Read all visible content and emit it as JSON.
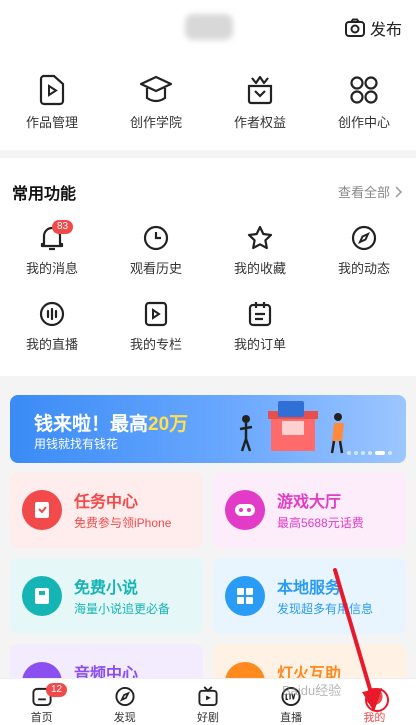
{
  "header": {
    "publish_label": "发布",
    "icon": "camera-icon"
  },
  "creator": [
    {
      "label": "作品管理",
      "icon": "video-doc-icon"
    },
    {
      "label": "创作学院",
      "icon": "graduation-cap-icon"
    },
    {
      "label": "作者权益",
      "icon": "crown-gift-icon"
    },
    {
      "label": "创作中心",
      "icon": "grid-icon"
    }
  ],
  "functions": {
    "title": "常用功能",
    "see_all": "查看全部",
    "items": [
      {
        "label": "我的消息",
        "icon": "bell-icon",
        "badge": "83"
      },
      {
        "label": "观看历史",
        "icon": "clock-icon"
      },
      {
        "label": "我的收藏",
        "icon": "star-icon"
      },
      {
        "label": "我的动态",
        "icon": "compass-icon"
      },
      {
        "label": "我的直播",
        "icon": "live-wave-icon"
      },
      {
        "label": "我的专栏",
        "icon": "play-doc-icon"
      },
      {
        "label": "我的订单",
        "icon": "order-icon"
      }
    ]
  },
  "banner": {
    "title_prefix": "钱来啦！最高",
    "title_highlight": "20万",
    "subtitle": "用钱就找有钱花"
  },
  "cards": [
    {
      "title": "任务中心",
      "subtitle": "免费参与领iPhone",
      "color": "#f24a4a",
      "bg": "#ffecec",
      "icon": "task-icon"
    },
    {
      "title": "游戏大厅",
      "subtitle": "最高5688元话费",
      "color": "#e23bc7",
      "bg": "#fdecfa",
      "icon": "gamepad-icon"
    },
    {
      "title": "免费小说",
      "subtitle": "海量小说追更必备",
      "color": "#16b5b5",
      "bg": "#e6f7f7",
      "icon": "book-icon"
    },
    {
      "title": "本地服务",
      "subtitle": "发现超多有用信息",
      "color": "#2a9cf4",
      "bg": "#e8f4fe",
      "icon": "service-grid-icon"
    },
    {
      "title": "音频中心",
      "color": "#8b4ef0",
      "bg": "#f2ecfe",
      "icon": "audio-icon"
    },
    {
      "title": "灯火互助",
      "color": "#ff8a1f",
      "bg": "#fff2e4",
      "icon": "lamp-icon"
    }
  ],
  "tabbar": [
    {
      "label": "首页",
      "icon": "home-icon",
      "badge": "12"
    },
    {
      "label": "发现",
      "icon": "compass-icon"
    },
    {
      "label": "好剧",
      "icon": "tv-icon"
    },
    {
      "label": "直播",
      "icon": "live-icon"
    },
    {
      "label": "我的",
      "icon": "profile-icon",
      "active": true
    }
  ],
  "watermark": "Baidu经验"
}
